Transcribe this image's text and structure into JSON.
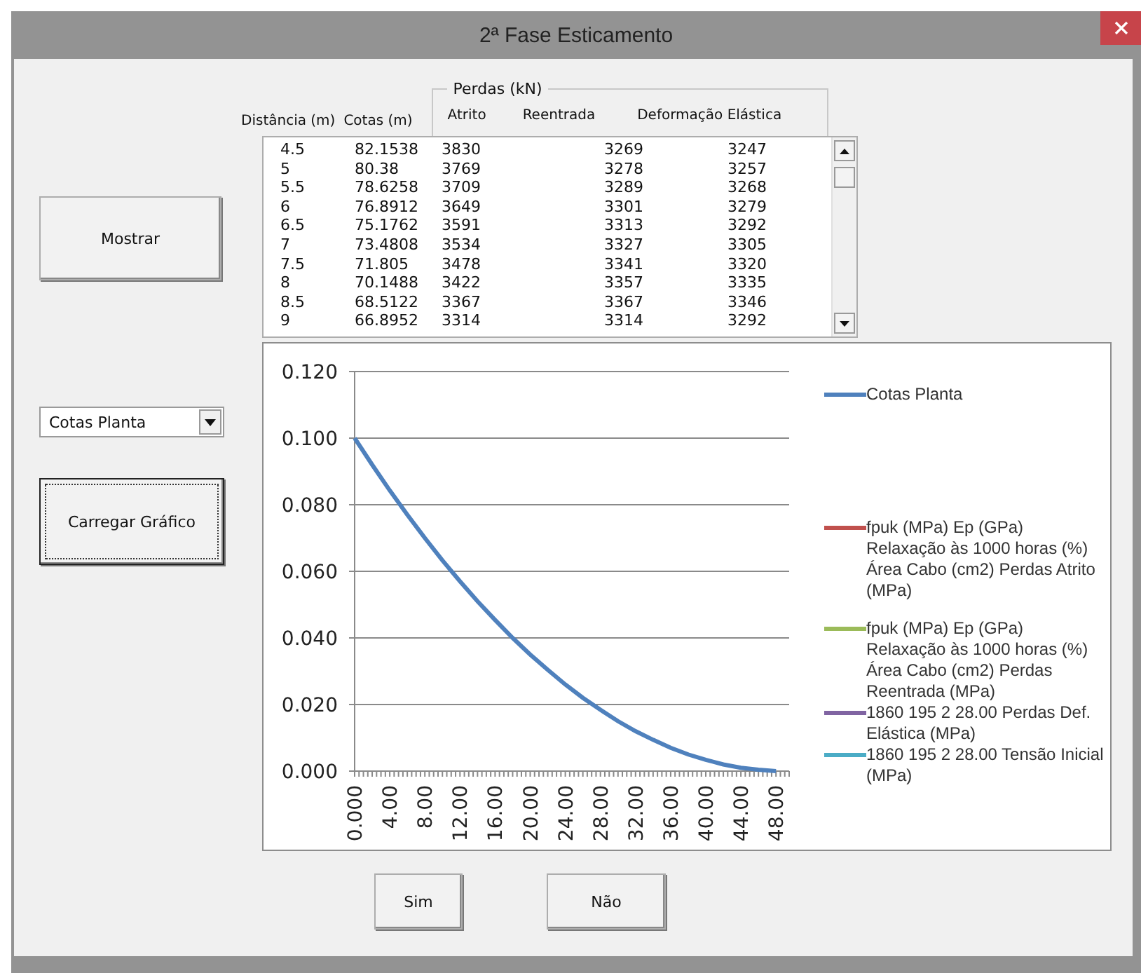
{
  "window": {
    "title": "2ª Fase Esticamento"
  },
  "show_button": {
    "label": "Mostrar"
  },
  "chart_selector": {
    "value": "Cotas Planta"
  },
  "load_chart_button": {
    "label": "Carregar Gráfico",
    "focused": true
  },
  "table": {
    "group_label": "Perdas (kN)",
    "columns": [
      "Distância (m)",
      "Cotas (m)",
      "Atrito",
      "Reentrada",
      "Deformação Elástica"
    ],
    "rows": [
      [
        "4.5",
        "82.1538",
        "3830",
        "3269",
        "3247"
      ],
      [
        "5",
        "80.38",
        "3769",
        "3278",
        "3257"
      ],
      [
        "5.5",
        "78.6258",
        "3709",
        "3289",
        "3268"
      ],
      [
        "6",
        "76.8912",
        "3649",
        "3301",
        "3279"
      ],
      [
        "6.5",
        "75.1762",
        "3591",
        "3313",
        "3292"
      ],
      [
        "7",
        "73.4808",
        "3534",
        "3327",
        "3305"
      ],
      [
        "7.5",
        "71.805",
        "3478",
        "3341",
        "3320"
      ],
      [
        "8",
        "70.1488",
        "3422",
        "3357",
        "3335"
      ],
      [
        "8.5",
        "68.5122",
        "3367",
        "3367",
        "3346"
      ],
      [
        "9",
        "66.8952",
        "3314",
        "3314",
        "3292"
      ]
    ]
  },
  "chart": {
    "chart_data": {
      "type": "line",
      "x": [
        0,
        2,
        4,
        6,
        8,
        10,
        12,
        14,
        16,
        18,
        20,
        22,
        24,
        26,
        28,
        30,
        32,
        34,
        36,
        38,
        40,
        42,
        44,
        46,
        48
      ],
      "xlim": [
        0,
        49.5
      ],
      "grid": true,
      "ylim": [
        0,
        0.12
      ],
      "xticks": [
        {
          "value": 0,
          "label": "0.000"
        },
        {
          "value": 4,
          "label": "4.00"
        },
        {
          "value": 8,
          "label": "8.00"
        },
        {
          "value": 12,
          "label": "12.00"
        },
        {
          "value": 16,
          "label": "16.00"
        },
        {
          "value": 20,
          "label": "20.00"
        },
        {
          "value": 24,
          "label": "24.00"
        },
        {
          "value": 28,
          "label": "28.00"
        },
        {
          "value": 32,
          "label": "32.00"
        },
        {
          "value": 36,
          "label": "36.00"
        },
        {
          "value": 40,
          "label": "40.00"
        },
        {
          "value": 44,
          "label": "44.00"
        },
        {
          "value": 48,
          "label": "48.00"
        }
      ],
      "yticks": [
        {
          "value": 0,
          "label": "0.000"
        },
        {
          "value": 0.02,
          "label": "0.020"
        },
        {
          "value": 0.04,
          "label": "0.040"
        },
        {
          "value": 0.06,
          "label": "0.060"
        },
        {
          "value": 0.08,
          "label": "0.080"
        },
        {
          "value": 0.1,
          "label": "0.100"
        },
        {
          "value": 0.12,
          "label": "0.120"
        }
      ],
      "series": [
        {
          "name": "Cotas Planta",
          "color": "#4f81bd",
          "values": [
            0.1,
            0.092,
            0.0843,
            0.077,
            0.07,
            0.0633,
            0.057,
            0.051,
            0.0454,
            0.04,
            0.035,
            0.0304,
            0.026,
            0.022,
            0.0184,
            0.015,
            0.012,
            0.0094,
            0.007,
            0.005,
            0.0034,
            0.002,
            0.001,
            0.0004,
            0.0
          ]
        },
        {
          "name": "fpuk (MPa) Ep (GPa) Relaxação às 1000 horas (%) Área Cabo (cm2) Perdas Atrito (MPa)",
          "color": "#c0504d",
          "values": [
            null,
            null,
            null,
            null,
            null,
            null,
            null,
            null,
            null,
            null,
            null,
            null,
            null,
            null,
            null,
            null,
            null,
            null,
            null,
            null,
            null,
            null,
            null,
            null,
            null
          ]
        },
        {
          "name": "fpuk (MPa) Ep (GPa) Relaxação às 1000 horas (%) Área Cabo (cm2) Perdas Reentrada (MPa)",
          "color": "#9bbb59",
          "values": [
            null,
            null,
            null,
            null,
            null,
            null,
            null,
            null,
            null,
            null,
            null,
            null,
            null,
            null,
            null,
            null,
            null,
            null,
            null,
            null,
            null,
            null,
            null,
            null,
            null
          ]
        },
        {
          "name": "1860 195 2 28.00 Perdas Def. Elástica (MPa)",
          "color": "#8064a2",
          "values": [
            null,
            null,
            null,
            null,
            null,
            null,
            null,
            null,
            null,
            null,
            null,
            null,
            null,
            null,
            null,
            null,
            null,
            null,
            null,
            null,
            null,
            null,
            null,
            null,
            null
          ]
        },
        {
          "name": "1860 195 2 28.00 Tensão Inicial (MPa)",
          "color": "#4bacc6",
          "values": [
            null,
            null,
            null,
            null,
            null,
            null,
            null,
            null,
            null,
            null,
            null,
            null,
            null,
            null,
            null,
            null,
            null,
            null,
            null,
            null,
            null,
            null,
            null,
            null,
            null
          ]
        }
      ]
    }
  },
  "dialog_buttons": [
    {
      "label": "Sim"
    },
    {
      "label": "Não"
    }
  ]
}
